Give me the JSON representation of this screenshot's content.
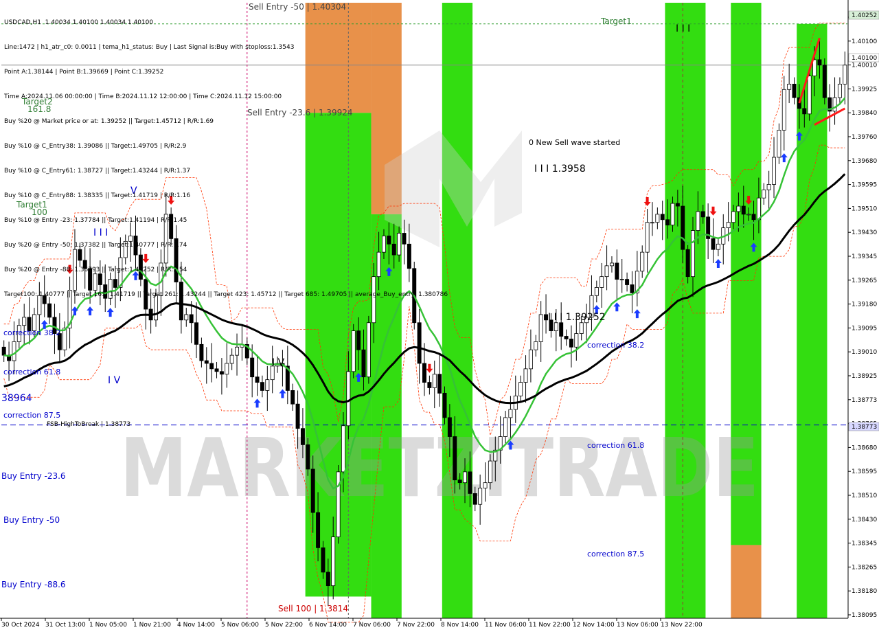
{
  "colors": {
    "background": "#ffffff",
    "frame": "#000000",
    "green_band": "#33dd11",
    "orange_band": "#e8914a",
    "price_label_bg": "#d8d8d8",
    "candle": "#000000",
    "ma_fast": "#36c236",
    "ma_slow": "#000000",
    "dashed_red": "#ff3300",
    "fsb_line": "#0000cc",
    "wave_marker": "#ff1a1a",
    "label_green": "#2e7d32",
    "label_blue": "#0000cc",
    "label_red": "#cc0000"
  },
  "header": {
    "symbol_line": "USDCAD,H1  1.40034 1.40100 1.40034 1.40100",
    "lines": [
      "Line:1472 | h1_atr_c0: 0.0011 | tema_h1_status: Buy | Last Signal is:Buy with stoploss:1.3543",
      "Point A:1.38144 | Point B:1.39669 | Point C:1.39252",
      "Time A:2024.11.06 00:00:00 | Time B:2024.11.12 12:00:00 | Time C:2024.11.12 15:00:00",
      "Buy %20 @ Market price or at: 1.39252 || Target:1.45712 | R/R:1.69",
      "Buy %10 @ C_Entry38: 1.39086 || Target:1.49705 | R/R:2.9",
      "Buy %10 @ C_Entry61: 1.38727 || Target:1.43244 | R/R:1.37",
      "Buy %10 @ C_Entry88: 1.38335 || Target:1.41719 | R/R:1.16",
      "Buy %10 @ Entry -23: 1.37784 || Target:1.41194 | R/R:1.45",
      "Buy %20 @ Entry -50: 1.37382 || Target:1.40777 | R/R:1.74",
      "Buy %20 @ Entry -88: 1.36793 || Target:1.40252 | R/R:2.54",
      "Target100: 1.40777 || Target 161: 1.41719 || Target 261: 1.43244 || Target 423: 1.45712 || Target 685: 1.49705 || average_Buy_entry: 1.380786"
    ]
  },
  "chart_data": {
    "type": "candlestick",
    "symbol": "USDCAD",
    "timeframe": "H1",
    "ohlc_last": {
      "open": 1.40034,
      "high": 1.401,
      "low": 1.40034,
      "close": 1.401
    },
    "y_ticks": [
      "1.40252",
      "1.40100",
      "1.40010",
      "1.39925",
      "1.39840",
      "1.39760",
      "1.39680",
      "1.39595",
      "1.39510",
      "1.39430",
      "1.39345",
      "1.39265",
      "1.39180",
      "1.39095",
      "1.39010",
      "1.38925",
      "1.38773",
      "1.38765",
      "1.38680",
      "1.38595",
      "1.38510",
      "1.38430",
      "1.38345",
      "1.38265",
      "1.38180",
      "1.38095"
    ],
    "x_ticks": [
      "30 Oct 2024",
      "31 Oct 13:00",
      "1 Nov 05:00",
      "1 Nov 21:00",
      "4 Nov 14:00",
      "5 Nov 06:00",
      "5 Nov 22:00",
      "6 Nov 14:00",
      "7 Nov 06:00",
      "7 Nov 22:00",
      "8 Nov 14:00",
      "11 Nov 06:00",
      "11 Nov 22:00",
      "12 Nov 14:00",
      "13 Nov 06:00",
      "13 Nov 22:00"
    ],
    "price_labels": {
      "target_price": "1.40252",
      "current_price": "1.40100",
      "fsb_price": "1.38773"
    },
    "ylim": [
      1.3806,
      1.4033
    ],
    "levels": {
      "target": 1.40252,
      "current": 1.401,
      "fsb_high_to_break": 1.38773
    },
    "zones": [
      {
        "color": "orange",
        "from": 60,
        "to": 72,
        "y_from": 1.4033,
        "y_to": 1.39924
      },
      {
        "color": "green",
        "from": 60,
        "to": 72,
        "y_from": 1.39924,
        "y_to": 1.3814
      },
      {
        "color": "orange",
        "from": 73,
        "to": 78,
        "y_from": 1.4033,
        "y_to": 1.3955
      },
      {
        "color": "green",
        "from": 73,
        "to": 78,
        "y_from": 1.3955,
        "y_to": 1.3806
      },
      {
        "color": "green",
        "from": 87,
        "to": 92,
        "y_from": 1.4033,
        "y_to": 1.3806
      },
      {
        "color": "green",
        "from": 131,
        "to": 138,
        "y_from": 1.4033,
        "y_to": 1.3806
      },
      {
        "color": "green",
        "from": 144,
        "to": 149,
        "y_from": 1.4033,
        "y_to": 1.3833
      },
      {
        "color": "orange",
        "from": 144,
        "to": 149,
        "y_from": 1.3833,
        "y_to": 1.3806
      },
      {
        "color": "green",
        "from": 157,
        "to": 162,
        "y_from": 1.40252,
        "y_to": 1.3806
      }
    ],
    "close": [
      1.3903,
      1.3901,
      1.3908,
      1.3914,
      1.3917,
      1.3912,
      1.3918,
      1.3925,
      1.3922,
      1.3917,
      1.3911,
      1.3905,
      1.3913,
      1.3927,
      1.3942,
      1.3938,
      1.3935,
      1.3927,
      1.3933,
      1.3929,
      1.3924,
      1.3931,
      1.3928,
      1.3939,
      1.3945,
      1.3947,
      1.394,
      1.3931,
      1.392,
      1.3916,
      1.3925,
      1.3937,
      1.3955,
      1.3946,
      1.393,
      1.3916,
      1.3918,
      1.3915,
      1.3907,
      1.3901,
      1.39,
      1.3898,
      1.3897,
      1.3896,
      1.39,
      1.3903,
      1.3906,
      1.3907,
      1.3902,
      1.3895,
      1.3893,
      1.389,
      1.3894,
      1.3899,
      1.39,
      1.3899,
      1.389,
      1.3885,
      1.3876,
      1.387,
      1.3861,
      1.3845,
      1.3832,
      1.3823,
      1.3818,
      1.3836,
      1.386,
      1.3877,
      1.3897,
      1.3912,
      1.3905,
      1.3895,
      1.3915,
      1.3932,
      1.3941,
      1.3947,
      1.3944,
      1.394,
      1.3948,
      1.3944,
      1.3935,
      1.3915,
      1.39,
      1.3893,
      1.3891,
      1.3896,
      1.3889,
      1.388,
      1.3873,
      1.3857,
      1.3856,
      1.386,
      1.3852,
      1.3848,
      1.3854,
      1.3856,
      1.3864,
      1.3868,
      1.3873,
      1.388,
      1.3883,
      1.3888,
      1.3893,
      1.3898,
      1.3905,
      1.3908,
      1.3918,
      1.3916,
      1.3912,
      1.3915,
      1.391,
      1.3909,
      1.3906,
      1.3911,
      1.3915,
      1.3917,
      1.3925,
      1.3928,
      1.3932,
      1.3936,
      1.3937,
      1.3931,
      1.3931,
      1.3929,
      1.3926,
      1.3934,
      1.3941,
      1.3952,
      1.3952,
      1.3955,
      1.3953,
      1.3951,
      1.3959,
      1.3958,
      1.3942,
      1.3932,
      1.3949,
      1.3956,
      1.3954,
      1.3946,
      1.3942,
      1.3944,
      1.395,
      1.3952,
      1.3956,
      1.3958,
      1.3955,
      1.3955,
      1.3953,
      1.3961,
      1.3964,
      1.3966,
      1.3976,
      1.3986,
      1.4001,
      1.4003,
      1.3998,
      1.3994,
      1.3992,
      1.4006,
      1.4012,
      1.401,
      1.3998,
      1.3993,
      1.3998,
      1.4003,
      1.401
    ],
    "ma_fast_note": "green moving average",
    "ma_slow_note": "black moving average"
  },
  "annotations": {
    "sell_entry_50": "Sell Entry -50 | 1.40304",
    "sell_entry_23": "Sell Entry -23.6 | 1.39924",
    "sell_100": "Sell 100 | 1.3814",
    "target1_top": "Target1",
    "target2": "Target2",
    "target2_pct": "161.8",
    "target1_left": "Target1",
    "target1_left_pct": "100",
    "new_sell_wave": "0 New Sell wave started",
    "wave_b_label": "I I I 1.3958",
    "wave_c_label": "I I I 1.39252",
    "wave_top_marks": "I I I",
    "wave_v_mark": "V",
    "wave_left_marks": "I I I",
    "wave_iv_mark": "I V",
    "wave_mid_mark": "I V",
    "left_price": "38964",
    "fsb_label": "FSB-HighToBreak | 1.38773",
    "correction_382_left": "correction 38.2",
    "correction_618_left": "correction 61.8",
    "correction_875_left": "correction 87.5",
    "buy_entry_236": "Buy Entry -23.6",
    "buy_entry_50": "Buy Entry -50",
    "buy_entry_886": "Buy Entry -88.6",
    "correction_382_right": "correction 38.2",
    "correction_618_right": "correction 61.8",
    "correction_875_right": "correction 87.5"
  },
  "watermark": {
    "text": "MARKETZITRADE"
  }
}
